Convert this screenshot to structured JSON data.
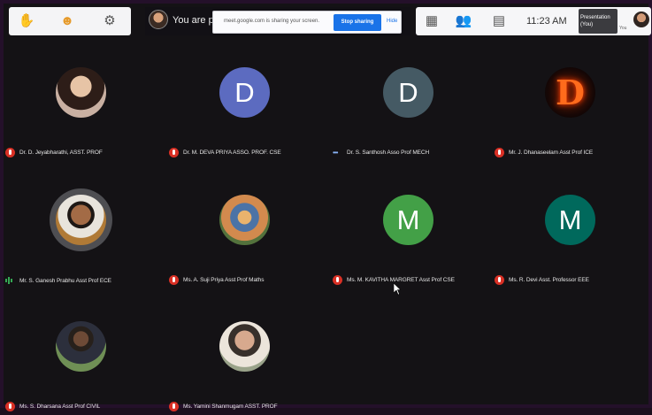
{
  "app": "Google Meet",
  "toolbar_left": {
    "icons": [
      "raise-hand-icon",
      "emoji-icon",
      "gear-icon"
    ]
  },
  "presenter_banner": {
    "text": "You are pre"
  },
  "share_bar": {
    "message": "meet.google.com is sharing your screen.",
    "stop_label": "Stop sharing",
    "hide_label": "Hide"
  },
  "toolbar_right": {
    "icons": [
      "grid-layout-icon",
      "people-icon",
      "chat-icon"
    ],
    "time": "11:23 AM",
    "presentation_label": "Presentation (You)",
    "you_label": "You"
  },
  "participants": [
    {
      "name": "Dr. D. Jeyabharathi, ASST. PROF",
      "avatar": "photo-f",
      "letter": "",
      "mic": "muted",
      "color": ""
    },
    {
      "name": "Dr. M. DEVA PRIYA ASSO. PROF. CSE",
      "avatar": "letter",
      "letter": "D",
      "mic": "muted",
      "color": "#5c6bc0"
    },
    {
      "name": "Dr. S. Santhosh Asso Prof MECH",
      "avatar": "letter",
      "letter": "D",
      "mic": "dots",
      "color": "#455a64"
    },
    {
      "name": "Mr. J. Dhanaseelam Asst Prof ICE",
      "avatar": "fire",
      "letter": "D",
      "mic": "muted",
      "color": ""
    },
    {
      "name": "Mr. S. Ganesh Prabhu Asst Prof ECE",
      "avatar": "photo-m",
      "letter": "",
      "mic": "active",
      "color": ""
    },
    {
      "name": "Ms. A. Suji Priya Asst Prof Maths",
      "avatar": "photo-g",
      "letter": "",
      "mic": "muted",
      "color": ""
    },
    {
      "name": "Ms. M. KAVITHA MARGRET Asst Prof CSE",
      "avatar": "letter",
      "letter": "M",
      "mic": "muted",
      "color": "#43a047"
    },
    {
      "name": "Ms. R. Devi Asst. Professor EEE",
      "avatar": "letter",
      "letter": "M",
      "mic": "muted",
      "color": "#00695c"
    },
    {
      "name": "Ms. S. Dharsana Asst Prof CIVIL",
      "avatar": "photo-s",
      "letter": "",
      "mic": "muted",
      "color": ""
    },
    {
      "name": "Ms. Yamini Shanmugam ASST. PROF",
      "avatar": "photo-y",
      "letter": "",
      "mic": "muted",
      "color": ""
    }
  ]
}
